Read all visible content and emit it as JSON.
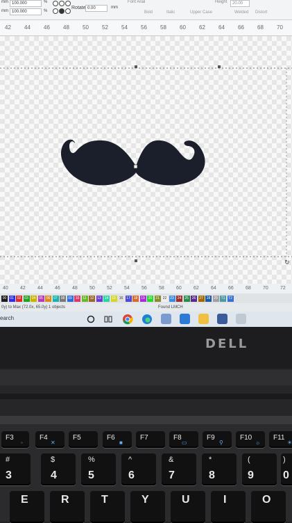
{
  "toolbar": {
    "unit1": "mm",
    "value1": "100.000",
    "unit2": "mm",
    "value2": "100.000",
    "pct1": "%",
    "pct2": "%",
    "rotate_label": "Rotate",
    "rotate_value": "0.00",
    "rotate_unit": "mm",
    "font_label": "Font  Arial",
    "height_label": "Height",
    "height_value": "20.00",
    "bold": "Bold",
    "italic": "Italic",
    "uppercase": "Upper Case",
    "welded": "Welded",
    "distort": "Distort"
  },
  "ruler_top": [
    "42",
    "44",
    "46",
    "48",
    "50",
    "52",
    "54",
    "56",
    "58",
    "60",
    "62",
    "64",
    "66",
    "68",
    "70"
  ],
  "ruler_bottom": [
    "40",
    "42",
    "44",
    "46",
    "48",
    "50",
    "52",
    "54",
    "56",
    "58",
    "60",
    "62",
    "64",
    "66",
    "68",
    "70",
    "72"
  ],
  "palette": [
    "00",
    "01",
    "02",
    "03",
    "04",
    "05",
    "06",
    "07",
    "08",
    "09",
    "10",
    "11",
    "12",
    "13",
    "14",
    "15",
    "16",
    "17",
    "18",
    "19",
    "20",
    "21",
    "22",
    "23",
    "24",
    "25",
    "26",
    "27",
    "28",
    "29",
    "T1",
    "T2"
  ],
  "palette_colors": [
    "#1a1a1a",
    "#2e2ee6",
    "#e02a2a",
    "#22a022",
    "#c8b400",
    "#b83ab8",
    "#d98a1e",
    "#1ab0b0",
    "#7a7a7a",
    "#2a6de0",
    "#d63c6a",
    "#6ab82a",
    "#9a6a2a",
    "#6a3ad6",
    "#2ad6a0",
    "#d6d62a",
    "#e0e0e0",
    "#4a4ad6",
    "#d66a2a",
    "#ad2ad6",
    "#2ad62a",
    "#8a8a2a",
    "#f0f0f0",
    "#3a8ae0",
    "#a02a2a",
    "#2a8a4a",
    "#5a2a8a",
    "#a06a00",
    "#1a5aa0",
    "#a0a0a0",
    "#4a9aa0",
    "#3a70d0"
  ],
  "status": {
    "left": "0y) to Max (72.0x, 65.0y)  1 objects",
    "right": "Found LMCH"
  },
  "taskbar": {
    "search_text": "earch"
  },
  "laptop": {
    "brand": "DELL"
  },
  "keys": {
    "fn_row": [
      {
        "label": "F3",
        "icon": "mic-icon"
      },
      {
        "label": "F4",
        "icon": "mute-icon"
      },
      {
        "label": "F5",
        "icon": ""
      },
      {
        "label": "F6",
        "icon": "lock-icon"
      },
      {
        "label": "F7",
        "icon": ""
      },
      {
        "label": "F8",
        "icon": "display-icon"
      },
      {
        "label": "F9",
        "icon": "search-icon"
      },
      {
        "label": "F10",
        "icon": "brightness-down-icon"
      },
      {
        "label": "F11",
        "icon": "brightness-up-icon"
      }
    ],
    "num_row": [
      {
        "top": "#",
        "bot": "3"
      },
      {
        "top": "$",
        "bot": "4"
      },
      {
        "top": "%",
        "bot": "5"
      },
      {
        "top": "^",
        "bot": "6"
      },
      {
        "top": "&",
        "bot": "7"
      },
      {
        "top": "*",
        "bot": "8"
      },
      {
        "top": "(",
        "bot": "9"
      },
      {
        "top": ")",
        "bot": "0"
      }
    ],
    "letter_row": [
      "E",
      "R",
      "T",
      "Y",
      "U",
      "I",
      "O"
    ]
  }
}
